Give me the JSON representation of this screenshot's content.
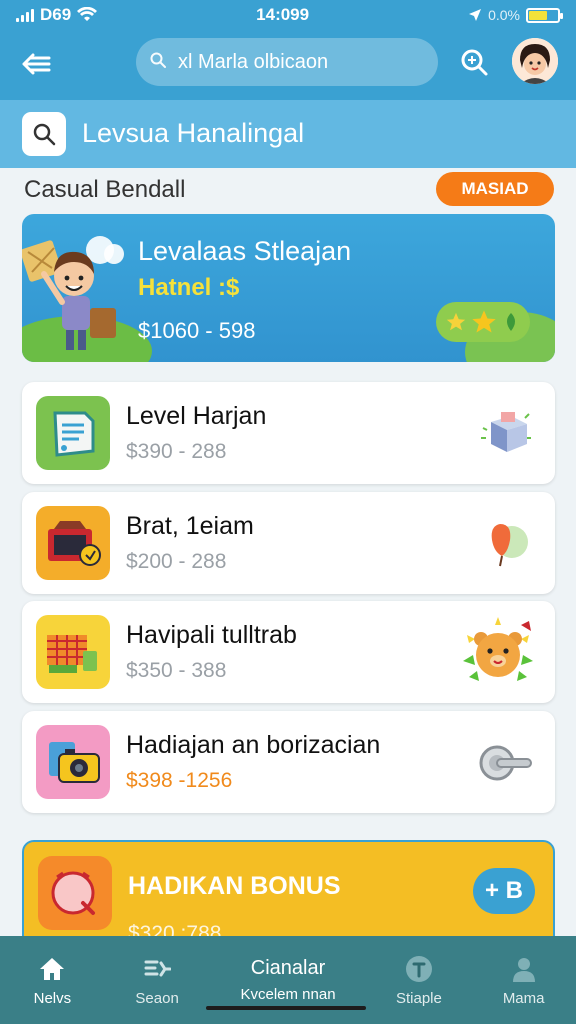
{
  "status_bar": {
    "carrier": "D69",
    "time": "14:099",
    "battery_text": "0.0%"
  },
  "header": {
    "search_text": "xl Marla olbicaon",
    "title": "Levsua Hanalingal"
  },
  "section": {
    "title": "Casual Bendall",
    "badge": "MASIAD"
  },
  "featured": {
    "title": "Levalaas Stleajan",
    "subtitle": "Hatnel :$",
    "price": "$1060 - 598"
  },
  "items": [
    {
      "name": "Level Harjan",
      "price": "$390 - 288"
    },
    {
      "name": "Brat, 1eiam",
      "price": "$200 - 288"
    },
    {
      "name": "Havipali tulltrab",
      "price": "$350 - 388"
    },
    {
      "name": "Hadiajan an borizacian",
      "price": "$398 -1256"
    }
  ],
  "bonus": {
    "title": "HADIKAN BONUS",
    "price": "$320 :788",
    "action": "+ B"
  },
  "nav": {
    "items": [
      {
        "label": "Nelvs"
      },
      {
        "label": "Seaon"
      },
      {
        "label": "Stiaple"
      },
      {
        "label": "Mama"
      }
    ],
    "center": {
      "title": "Cianalar",
      "subtitle": "Kvcelem nnan"
    }
  },
  "colors": {
    "primary": "#3aa1d2",
    "accent": "#f57b17",
    "bonus": "#f4be24",
    "nav": "#3a7f87"
  }
}
